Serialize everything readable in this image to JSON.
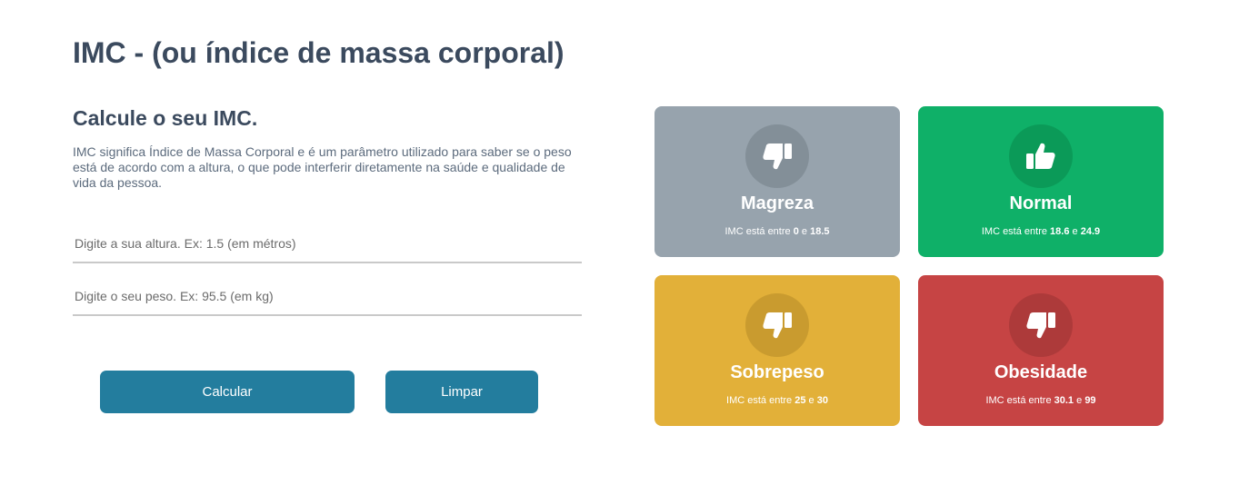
{
  "page": {
    "title": "IMC - (ou índice de massa corporal)"
  },
  "form": {
    "subtitle": "Calcule o seu IMC.",
    "description": "IMC significa Índice de Massa Corporal e é um parâmetro utilizado para saber se o peso está de acordo com a altura, o que pode interferir diretamente na saúde e qualidade de vida da pessoa.",
    "altura_placeholder": "Digite a sua altura. Ex: 1.5 (em métros)",
    "peso_placeholder": "Digite o seu peso. Ex: 95.5 (em kg)",
    "calcular_label": "Calcular",
    "limpar_label": "Limpar"
  },
  "categories": [
    {
      "name": "Magreza",
      "prefix": "IMC está entre",
      "min": "0",
      "conj": "e",
      "max": "18.5",
      "icon": "thumbs-down-icon",
      "color": "#97a3ad"
    },
    {
      "name": "Normal",
      "prefix": "IMC está entre",
      "min": "18.6",
      "conj": "e",
      "max": "24.9",
      "icon": "thumbs-up-icon",
      "color": "#0fb068"
    },
    {
      "name": "Sobrepeso",
      "prefix": "IMC está entre",
      "min": "25",
      "conj": "e",
      "max": "30",
      "icon": "thumbs-down-icon",
      "color": "#e2b039"
    },
    {
      "name": "Obesidade",
      "prefix": "IMC está entre",
      "min": "30.1",
      "conj": "e",
      "max": "99",
      "icon": "thumbs-down-icon",
      "color": "#c64444"
    }
  ]
}
